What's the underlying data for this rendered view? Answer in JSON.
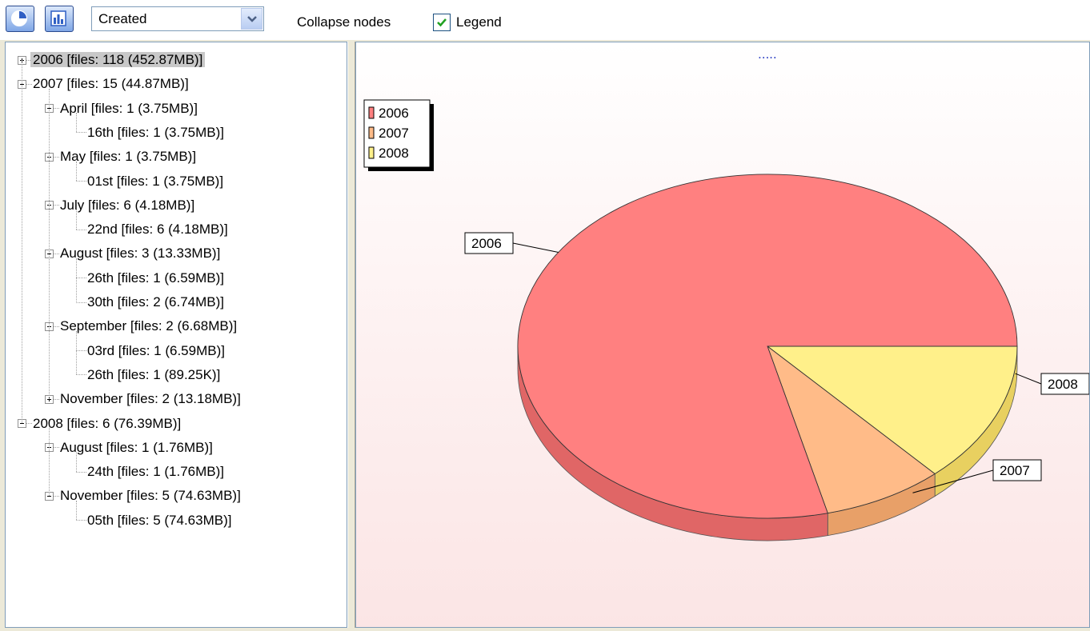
{
  "toolbar": {
    "pie_icon": "pie-chart-icon",
    "bar_icon": "bar-chart-icon",
    "group_by": "Created",
    "collapse_nodes_label": "Collapse nodes",
    "legend_label": "Legend",
    "legend_checked": true
  },
  "tree": {
    "nodes": [
      {
        "text": "2006 [files: 118 (452.87MB)]",
        "level": 0,
        "expander": "plus",
        "selected": true
      },
      {
        "text": "2007 [files: 15 (44.87MB)]",
        "level": 0,
        "expander": "minus"
      },
      {
        "text": "April [files: 1 (3.75MB)]",
        "level": 1,
        "expander": "minus"
      },
      {
        "text": "16th [files: 1 (3.75MB)]",
        "level": 2,
        "expander": "none"
      },
      {
        "text": "May [files: 1 (3.75MB)]",
        "level": 1,
        "expander": "minus"
      },
      {
        "text": "01st [files: 1 (3.75MB)]",
        "level": 2,
        "expander": "none"
      },
      {
        "text": "July [files: 6 (4.18MB)]",
        "level": 1,
        "expander": "minus"
      },
      {
        "text": "22nd [files: 6 (4.18MB)]",
        "level": 2,
        "expander": "none"
      },
      {
        "text": "August [files: 3 (13.33MB)]",
        "level": 1,
        "expander": "minus"
      },
      {
        "text": "26th [files: 1 (6.59MB)]",
        "level": 2,
        "expander": "none"
      },
      {
        "text": "30th [files: 2 (6.74MB)]",
        "level": 2,
        "expander": "none"
      },
      {
        "text": "September [files: 2 (6.68MB)]",
        "level": 1,
        "expander": "minus"
      },
      {
        "text": "03rd [files: 1 (6.59MB)]",
        "level": 2,
        "expander": "none"
      },
      {
        "text": "26th [files: 1 (89.25K)]",
        "level": 2,
        "expander": "none"
      },
      {
        "text": "November [files: 2 (13.18MB)]",
        "level": 1,
        "expander": "plus"
      },
      {
        "text": "2008 [files: 6 (76.39MB)]",
        "level": 0,
        "expander": "minus"
      },
      {
        "text": "August [files: 1 (1.76MB)]",
        "level": 1,
        "expander": "minus"
      },
      {
        "text": "24th [files: 1 (1.76MB)]",
        "level": 2,
        "expander": "none"
      },
      {
        "text": "November [files: 5 (74.63MB)]",
        "level": 1,
        "expander": "minus"
      },
      {
        "text": "05th [files: 5 (74.63MB)]",
        "level": 2,
        "expander": "none"
      }
    ]
  },
  "chart_data": {
    "type": "pie",
    "title": ".....",
    "categories": [
      "2006",
      "2007",
      "2008"
    ],
    "values": [
      452.87,
      44.87,
      76.39
    ],
    "unit": "MB",
    "colors": [
      "#ff8080",
      "#ffbb88",
      "#fff08a"
    ],
    "side_colors": [
      "#e06666",
      "#e8a068",
      "#e8d060"
    ],
    "legend": [
      "2006",
      "2007",
      "2008"
    ],
    "legend_position": "top-left",
    "three_d": true
  }
}
